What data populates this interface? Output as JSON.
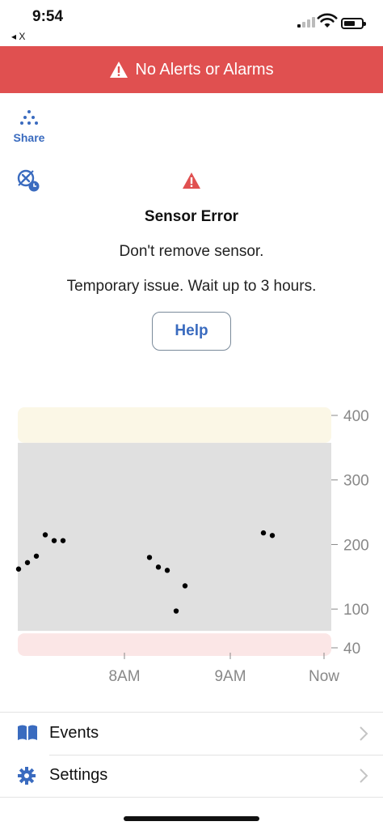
{
  "status_bar": {
    "time": "9:54",
    "back_app": "◂ X",
    "icons": [
      "cellular-signal-icon",
      "wifi-icon",
      "battery-icon"
    ]
  },
  "alert_banner": {
    "text": "No Alerts or Alarms",
    "icon": "warning-triangle-icon",
    "color": "#e05050"
  },
  "share": {
    "label": "Share",
    "icon": "share-dots-icon",
    "color": "#3a6bbf"
  },
  "sensor_issue": {
    "icon": "sensor-issue-icon",
    "title": "Sensor Error",
    "line1": "Don't remove sensor.",
    "line2": "Temporary issue. Wait up to 3 hours.",
    "help_label": "Help",
    "warning_color": "#e05050"
  },
  "chart_data": {
    "type": "scatter",
    "ylim": [
      40,
      400
    ],
    "y_ticks": [
      "400",
      "300",
      "200",
      "100",
      "40"
    ],
    "x_ticks": [
      "8AM",
      "9AM",
      "Now"
    ],
    "high_zone_min": 350,
    "low_zone_max": 70,
    "points": [
      162,
      172,
      182,
      215,
      206,
      206,
      180,
      165,
      160,
      97,
      136,
      218,
      214
    ],
    "colors": {
      "high_zone": "#fbf7e6",
      "target_zone": "#e0e0e0",
      "low_zone": "#fbe6e6",
      "point": "#000000",
      "axis_text": "#888888"
    }
  },
  "menu": {
    "items": [
      {
        "label": "Events",
        "icon": "book-icon"
      },
      {
        "label": "Settings",
        "icon": "gear-icon"
      }
    ]
  }
}
